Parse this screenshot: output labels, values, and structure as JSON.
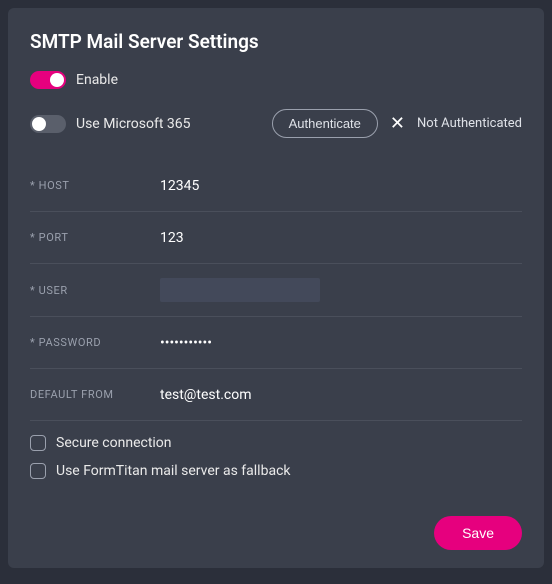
{
  "title": "SMTP Mail Server Settings",
  "enable": {
    "label": "Enable",
    "on": true
  },
  "ms365": {
    "label": "Use Microsoft 365",
    "on": false
  },
  "auth_button": "Authenticate",
  "auth_status": "Not Authenticated",
  "fields": {
    "host": {
      "label": "* HOST",
      "value": "12345"
    },
    "port": {
      "label": "* PORT",
      "value": "123"
    },
    "user": {
      "label": "* USER",
      "value": ""
    },
    "password": {
      "label": "* PASSWORD",
      "value": "•••••••••••"
    },
    "from": {
      "label": "DEFAULT FROM",
      "value": "test@test.com"
    }
  },
  "checkboxes": {
    "secure": {
      "label": "Secure connection",
      "checked": false
    },
    "fallback": {
      "label": "Use FormTitan mail server as fallback",
      "checked": false
    }
  },
  "save": "Save"
}
